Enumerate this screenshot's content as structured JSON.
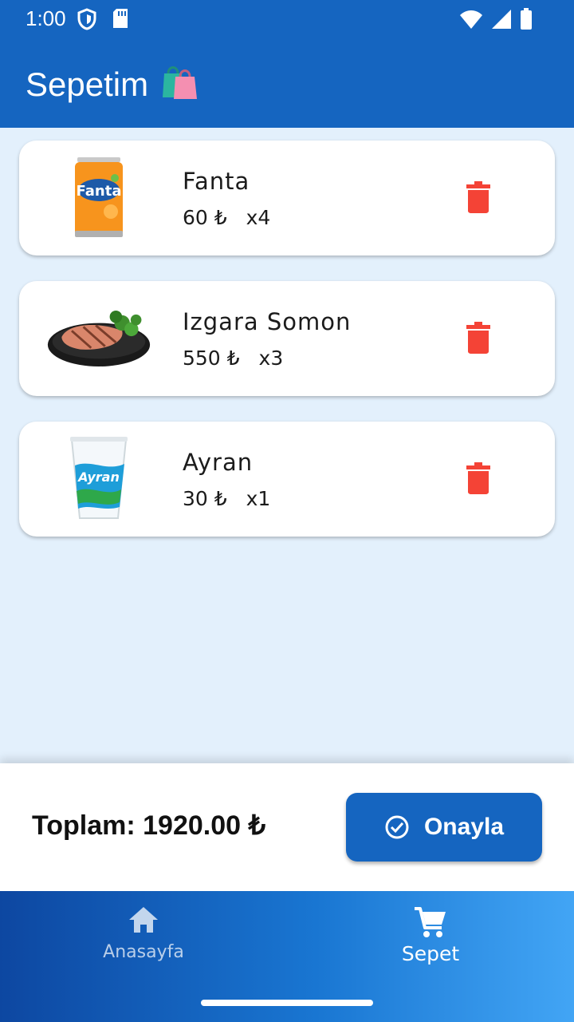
{
  "status_bar": {
    "time": "1:00"
  },
  "app_bar": {
    "title": "Sepetim",
    "title_emoji": "🛍️"
  },
  "cart": {
    "items": [
      {
        "name": "Fanta",
        "price": "60 ₺",
        "qty": "x4",
        "image": "fanta-can"
      },
      {
        "name": "Izgara Somon",
        "price": "550 ₺",
        "qty": "x3",
        "image": "grilled-salmon-plate"
      },
      {
        "name": "Ayran",
        "price": "30 ₺",
        "qty": "x1",
        "image": "ayran-cup"
      }
    ]
  },
  "summary": {
    "total_label": "Toplam: 1920.00 ₺",
    "confirm_label": "Onayla"
  },
  "nav": {
    "items": [
      {
        "label": "Anasayfa",
        "icon": "home-icon",
        "active": false
      },
      {
        "label": "Sepet",
        "icon": "cart-icon",
        "active": true
      }
    ]
  },
  "colors": {
    "primary": "#1565c0",
    "background": "#e3f0fc",
    "delete": "#f44336"
  }
}
